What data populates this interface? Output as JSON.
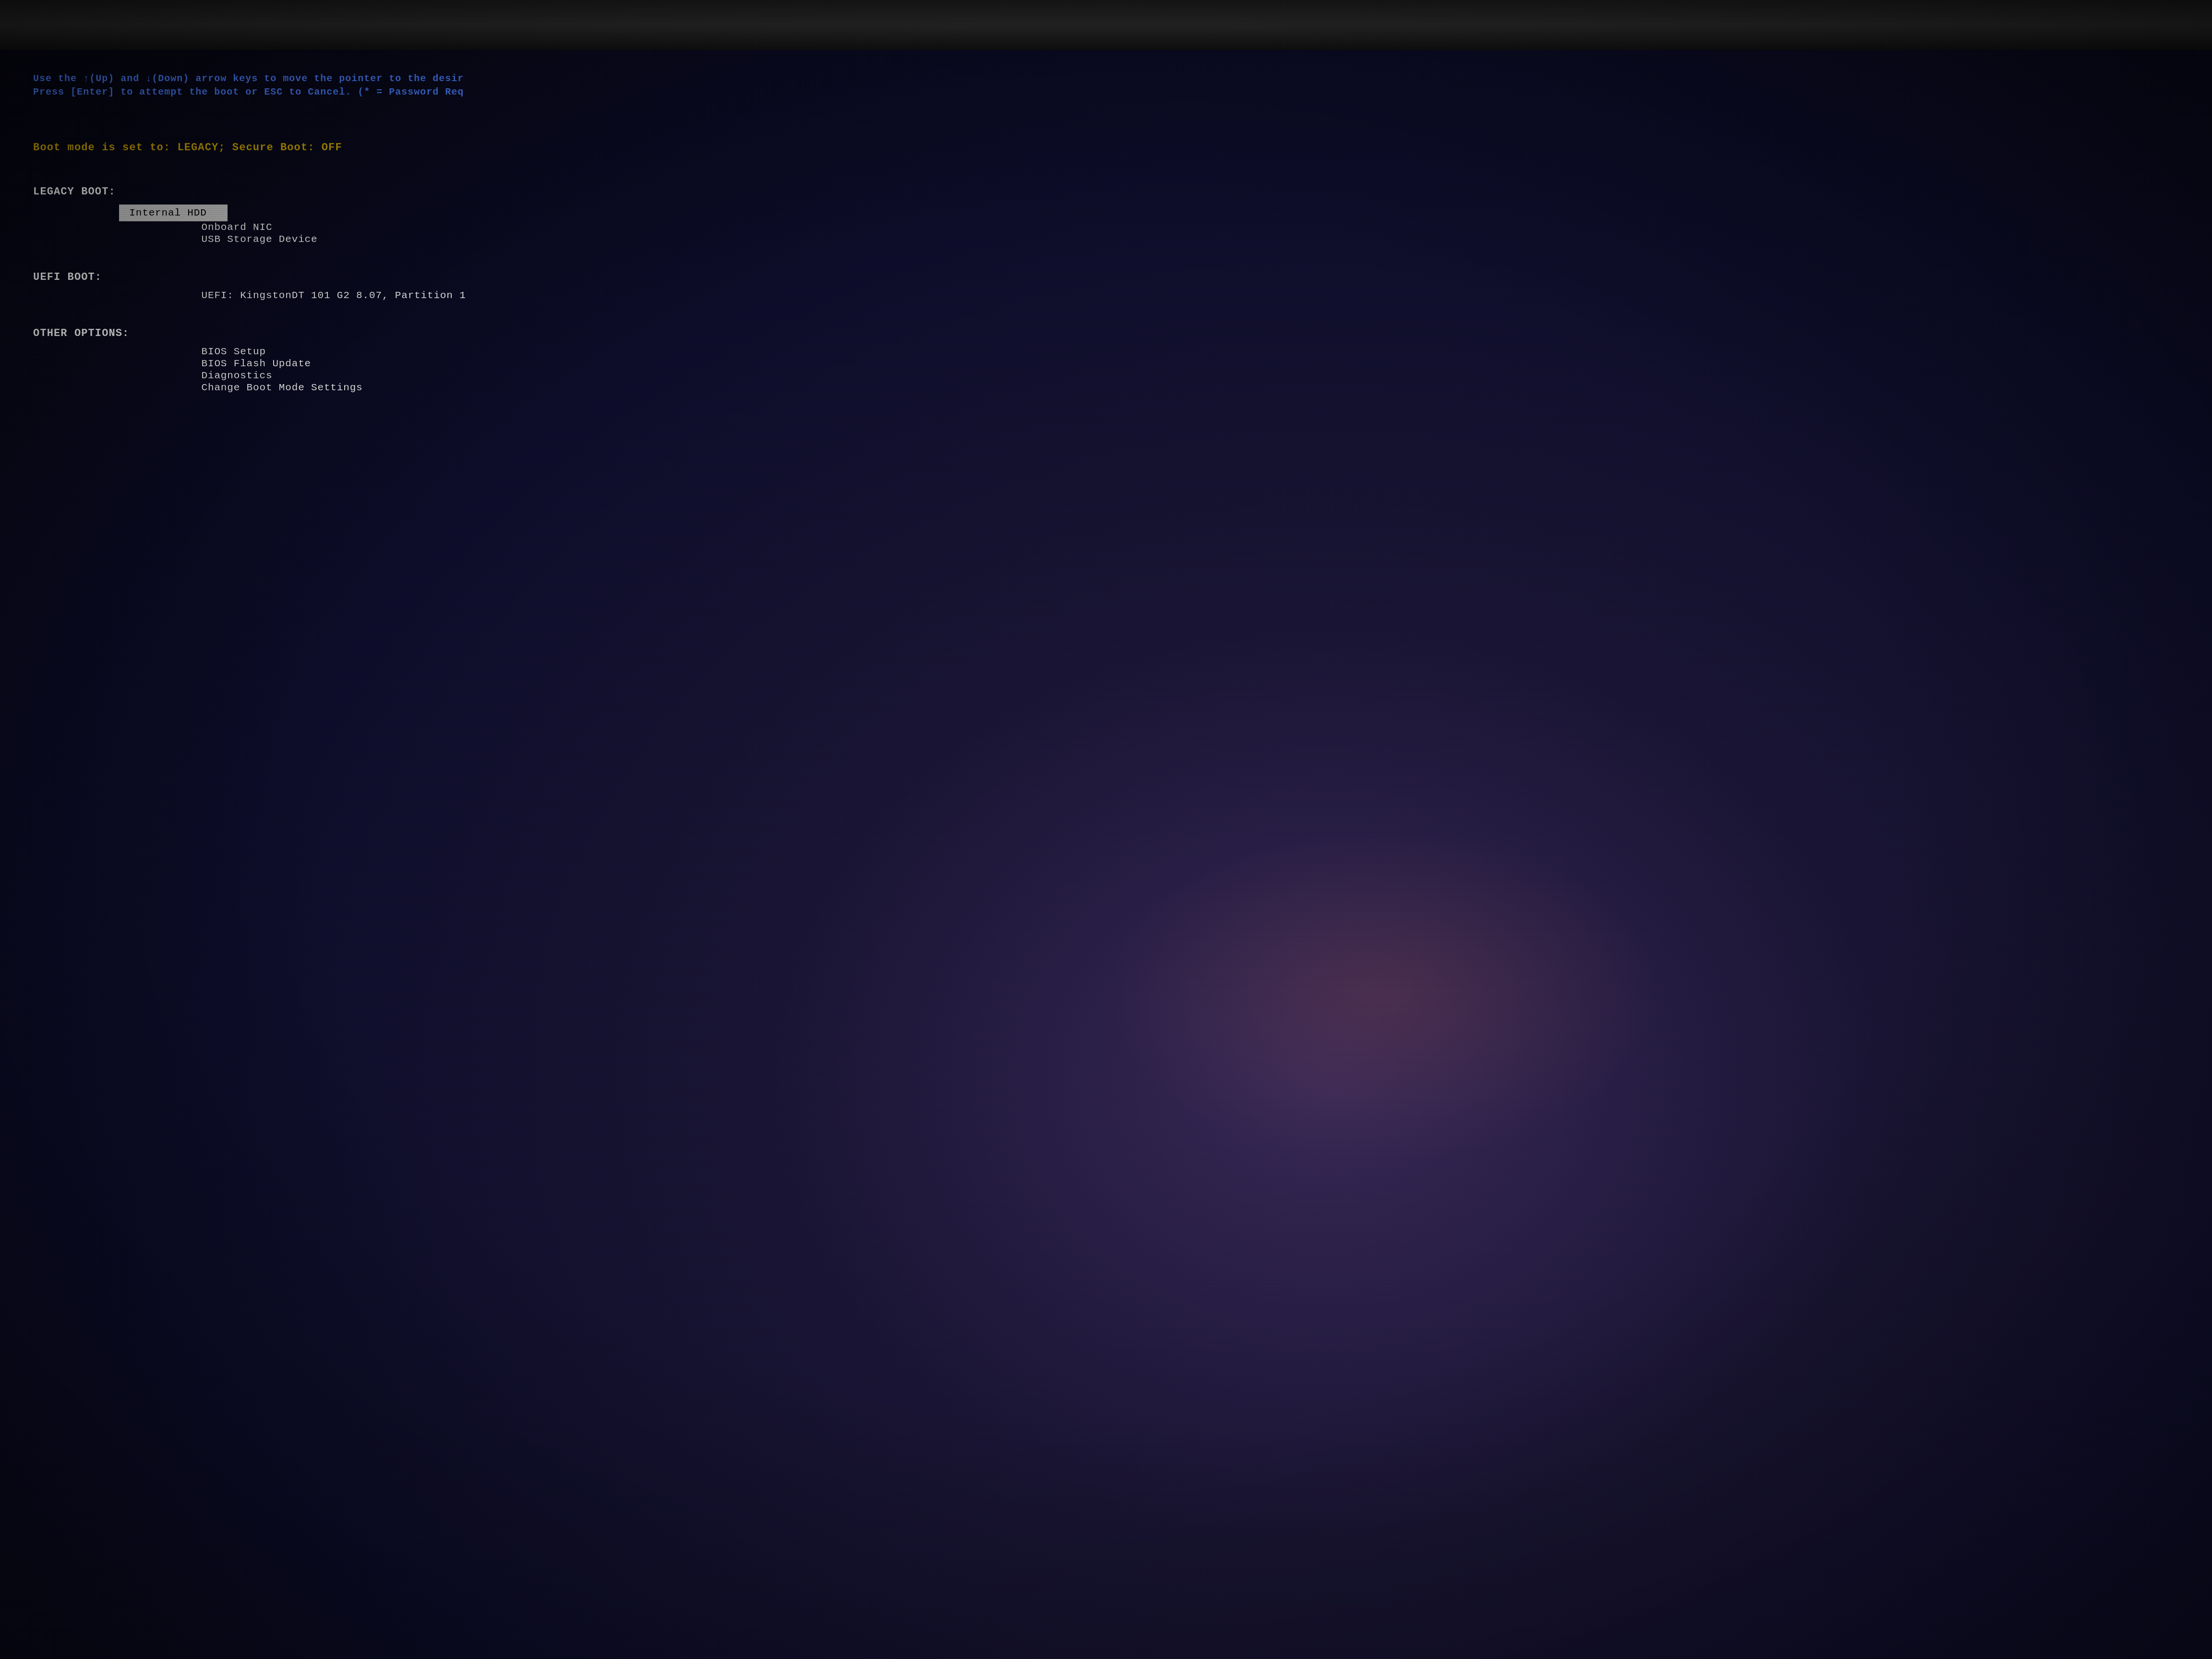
{
  "screen": {
    "bezel": {
      "top_bg": "#1a1a1a"
    },
    "instructions": {
      "line1": "Use the ↑(Up) and ↓(Down) arrow keys to move the pointer to the desir",
      "line2": "Press [Enter] to attempt the boot or ESC to Cancel. (* = Password Req"
    },
    "boot_mode_line": "Boot mode is set to: LEGACY; Secure Boot: OFF",
    "sections": [
      {
        "id": "legacy-boot",
        "header": "LEGACY BOOT:",
        "items": [
          {
            "label": "Internal HDD",
            "selected": true
          },
          {
            "label": "Onboard NIC",
            "selected": false
          },
          {
            "label": "USB Storage Device",
            "selected": false
          }
        ]
      },
      {
        "id": "uefi-boot",
        "header": "UEFI BOOT:",
        "items": [
          {
            "label": "UEFI: KingstonDT 101 G2 8.07, Partition 1",
            "selected": false
          }
        ]
      },
      {
        "id": "other-options",
        "header": "OTHER OPTIONS:",
        "items": [
          {
            "label": "BIOS Setup",
            "selected": false
          },
          {
            "label": "BIOS Flash Update",
            "selected": false
          },
          {
            "label": "Diagnostics",
            "selected": false
          },
          {
            "label": "Change Boot Mode Settings",
            "selected": false
          }
        ]
      }
    ]
  }
}
